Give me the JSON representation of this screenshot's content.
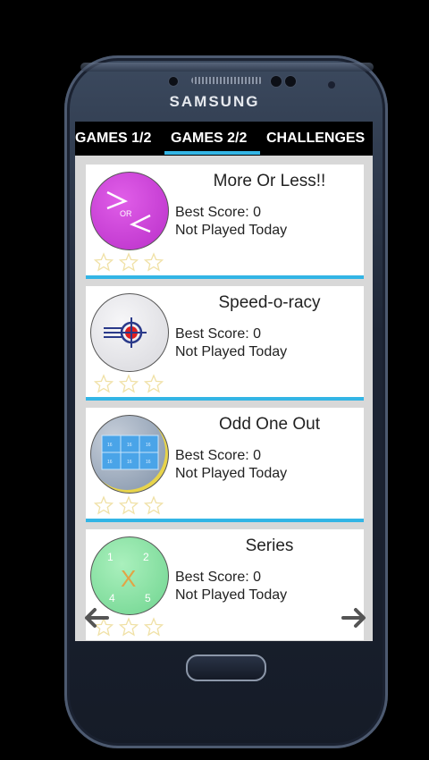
{
  "device": {
    "brand": "SAMSUNG"
  },
  "tabs": [
    {
      "label": "GAMES 1/2"
    },
    {
      "label": "GAMES 2/2"
    },
    {
      "label": "CHALLENGES"
    }
  ],
  "games": [
    {
      "title": "More Or Less!!",
      "best_score": "Best Score: 0",
      "status": "Not Played Today",
      "icon_text": "OR",
      "icon": "greater-less-icon",
      "color": "#c83ad6"
    },
    {
      "title": "Speed-o-racy",
      "best_score": "Best Score: 0",
      "status": "Not Played Today",
      "icon": "target-icon",
      "color": "#e6e6ea"
    },
    {
      "title": "Odd One Out",
      "best_score": "Best Score: 0",
      "status": "Not Played Today",
      "icon": "grid-icon",
      "color": "#8fa2b8",
      "grid_labels": [
        "16",
        "16",
        "16",
        "16",
        "16",
        "16"
      ]
    },
    {
      "title": "Series",
      "best_score": "Best Score: 0",
      "status": "Not Played Today",
      "icon": "series-icon",
      "color": "#8ee3a6",
      "icon_numbers": [
        "1",
        "2",
        "4",
        "5"
      ],
      "icon_symbol": "X"
    }
  ],
  "colors": {
    "accent": "#33b5e5",
    "star": "#f0e1a6"
  }
}
